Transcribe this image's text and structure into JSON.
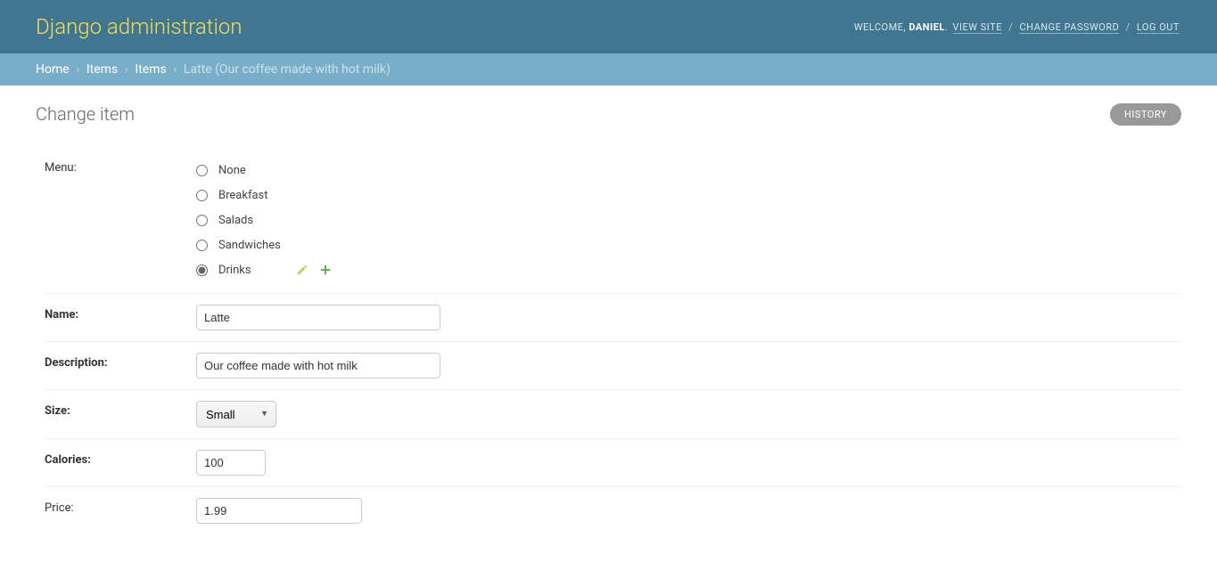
{
  "header": {
    "branding": "Django administration",
    "welcome": "WELCOME,",
    "username": "DANIEL",
    "view_site": "VIEW SITE",
    "change_password": "CHANGE PASSWORD",
    "log_out": "LOG OUT",
    "sep": "/"
  },
  "breadcrumbs": {
    "home": "Home",
    "app": "Items",
    "model": "Items",
    "current": "Latte (Our coffee made with hot milk)",
    "sep": "›"
  },
  "page": {
    "title": "Change item",
    "history_label": "HISTORY"
  },
  "form": {
    "menu": {
      "label": "Menu:",
      "options": [
        {
          "label": "None",
          "checked": false
        },
        {
          "label": "Breakfast",
          "checked": false
        },
        {
          "label": "Salads",
          "checked": false
        },
        {
          "label": "Sandwiches",
          "checked": false
        },
        {
          "label": "Drinks",
          "checked": true
        }
      ]
    },
    "name": {
      "label": "Name:",
      "value": "Latte"
    },
    "description": {
      "label": "Description:",
      "value": "Our coffee made with hot milk"
    },
    "size": {
      "label": "Size:",
      "selected": "Small"
    },
    "calories": {
      "label": "Calories:",
      "value": "100"
    },
    "price": {
      "label": "Price:",
      "value": "1.99"
    }
  }
}
